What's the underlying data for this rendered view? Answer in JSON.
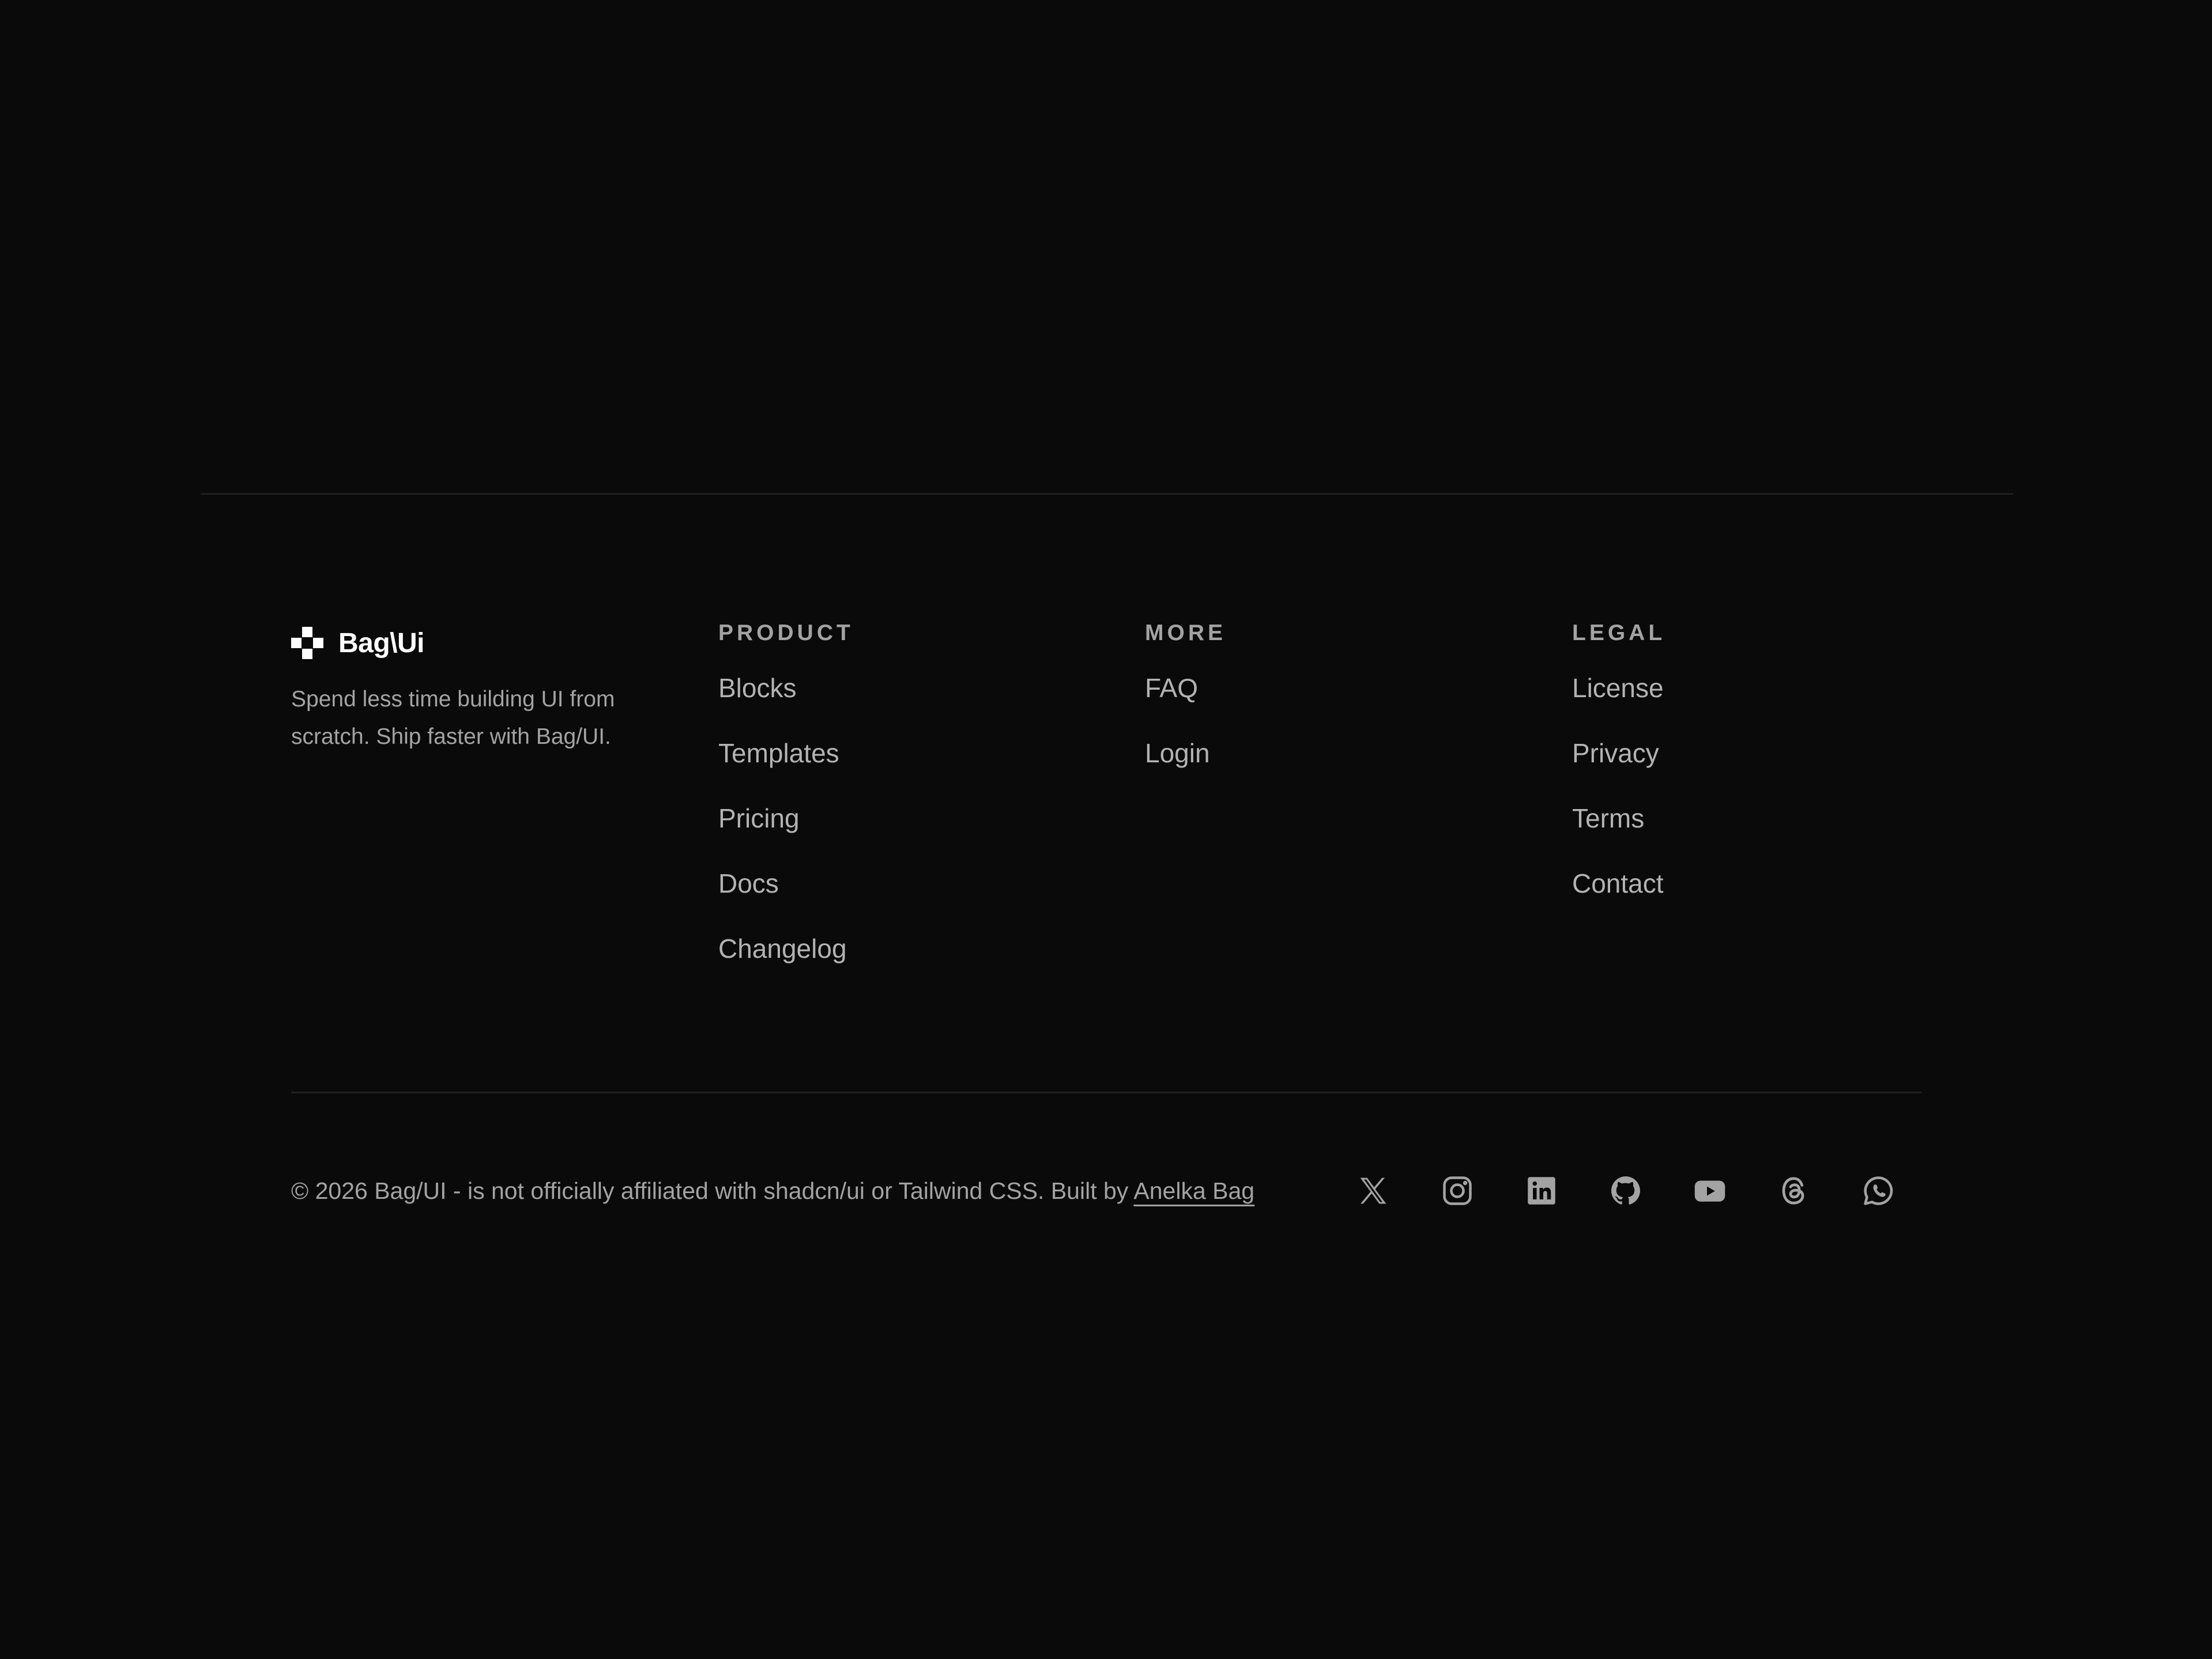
{
  "brand": {
    "name": "Bag\\Ui",
    "tagline": "Spend less time building UI from scratch. Ship faster with Bag/UI."
  },
  "columns": [
    {
      "title": "PRODUCT",
      "links": [
        "Blocks",
        "Templates",
        "Pricing",
        "Docs",
        "Changelog"
      ]
    },
    {
      "title": "MORE",
      "links": [
        "FAQ",
        "Login"
      ]
    },
    {
      "title": "LEGAL",
      "links": [
        "License",
        "Privacy",
        "Terms",
        "Contact"
      ]
    }
  ],
  "footer": {
    "copyright": "© 2026 Bag/UI - is not officially affiliated with shadcn/ui or Tailwind CSS. Built by ",
    "author": "Anelka Bag"
  },
  "socials": [
    {
      "icon": "x-icon"
    },
    {
      "icon": "instagram-icon"
    },
    {
      "icon": "linkedin-icon"
    },
    {
      "icon": "github-icon"
    },
    {
      "icon": "youtube-icon"
    },
    {
      "icon": "threads-icon"
    },
    {
      "icon": "whatsapp-icon"
    }
  ],
  "colors": {
    "background": "#0a0a0a",
    "text": "#a3a3a3",
    "brand": "#ffffff",
    "divider": "#1f1f1f"
  }
}
